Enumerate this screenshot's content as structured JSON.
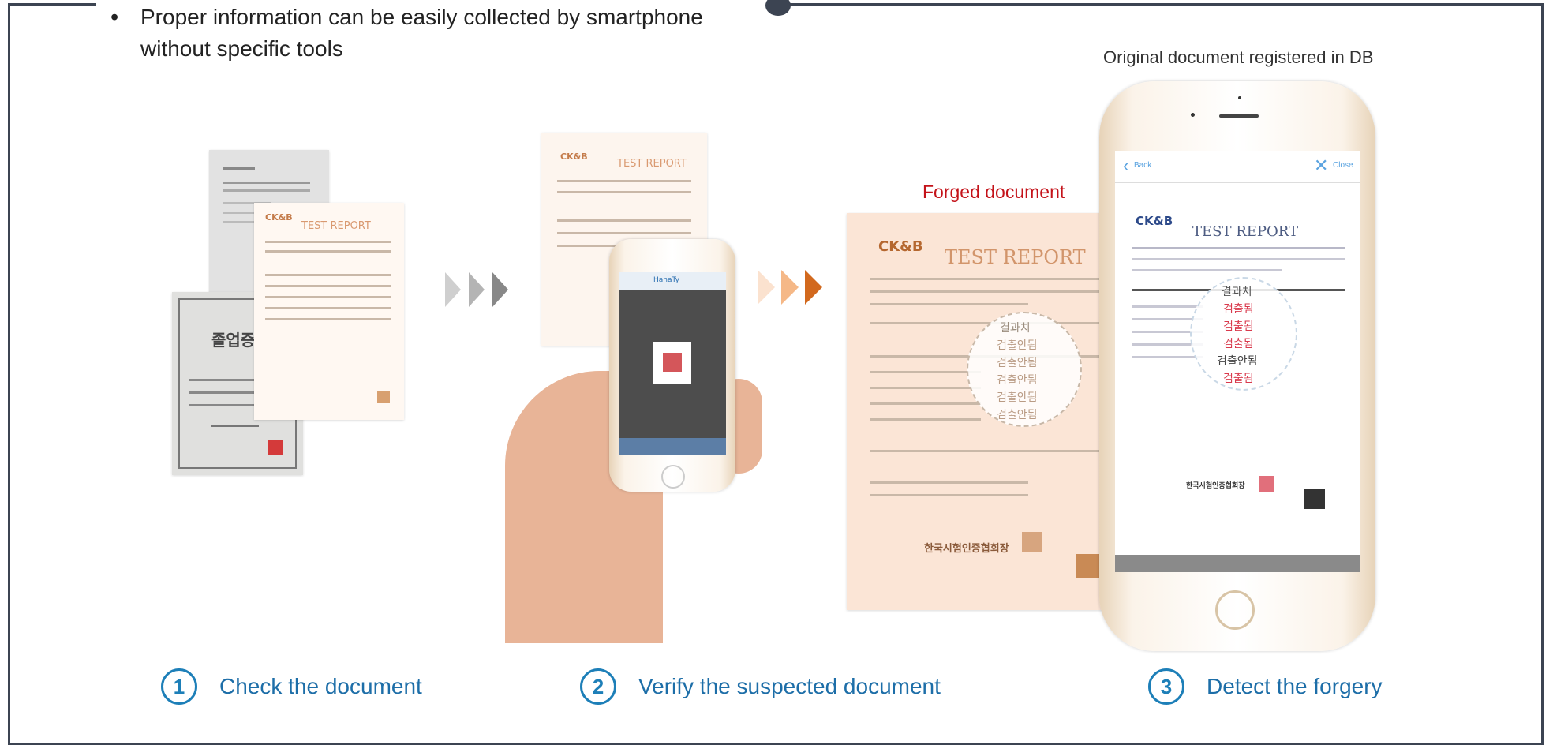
{
  "header": {
    "bullet": "•",
    "text": "Proper information can be easily collected by smartphone without specific tools"
  },
  "captions": {
    "original_db": "Original document registered in DB",
    "forged": "Forged document"
  },
  "documents": {
    "report_logo": "CK&B",
    "report_title": "TEST REPORT",
    "certificate_title": "졸업증",
    "zoom_rows": [
      "결과치",
      "검출안됨",
      "검출안됨",
      "검출안됨",
      "검출안됨",
      "검출안됨"
    ],
    "zoom_rows_db": [
      "결과치",
      "검출됨",
      "검출됨",
      "검출됨",
      "검출안됨",
      "검출됨"
    ],
    "phone_nav_back": "Back",
    "phone_nav_close": "Close",
    "phone_brand": "HanaTy",
    "seal_text": "한국시험인증협회장"
  },
  "steps": [
    {
      "num": "1",
      "label": "Check the document"
    },
    {
      "num": "2",
      "label": "Verify the suspected document"
    },
    {
      "num": "3",
      "label": "Detect the forgery"
    }
  ],
  "colors": {
    "frame": "#3c4452",
    "step_blue": "#1d7fb8",
    "forged_red": "#c4131a",
    "arrow_grey": "#999999",
    "arrow_orange": "#d2691e"
  }
}
